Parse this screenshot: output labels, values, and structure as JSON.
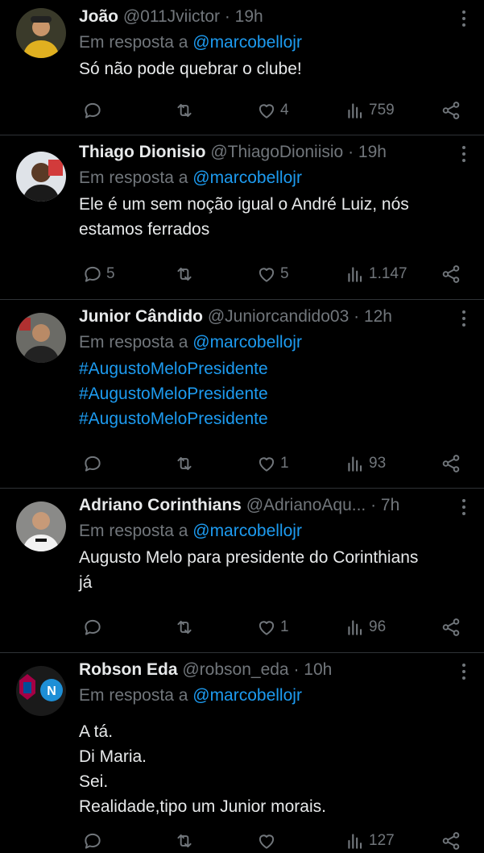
{
  "tweets": [
    {
      "name": "João",
      "handle": "@011Jviictor",
      "time": "· 19h",
      "reply_label": "Em resposta a",
      "reply_to": "@marcobellojr",
      "lines": [
        "Só não pode quebrar o clube!"
      ],
      "replies": "",
      "likes": "4",
      "views": "759"
    },
    {
      "name": "Thiago Dionisio",
      "handle": "@ThiagoDioniisio",
      "time": "· 19h",
      "reply_label": "Em resposta a",
      "reply_to": "@marcobellojr",
      "lines": [
        "Ele é um sem noção igual o André Luiz, nós",
        "estamos ferrados"
      ],
      "replies": "5",
      "likes": "5",
      "views": "1.147"
    },
    {
      "name": "Junior Cândido",
      "handle": "@Juniorcandido03",
      "time": "· 12h",
      "reply_label": "Em resposta a",
      "reply_to": "@marcobellojr",
      "lines": [
        "#AugustoMeloPresidente",
        "#AugustoMeloPresidente",
        "#AugustoMeloPresidente"
      ],
      "replies": "",
      "likes": "1",
      "views": "93"
    },
    {
      "name": "Adriano Corinthians",
      "handle": "@AdrianoAqu...",
      "time": "· 7h",
      "reply_label": "Em resposta a",
      "reply_to": "@marcobellojr",
      "lines": [
        "Augusto Melo para presidente do Corinthians",
        "já"
      ],
      "replies": "",
      "likes": "1",
      "views": "96"
    },
    {
      "name": "Robson Eda",
      "handle": "@robson_eda",
      "time": "· 10h",
      "reply_label": "Em resposta a",
      "reply_to": "@marcobellojr",
      "lines": [
        "A tá.",
        "Di Maria.",
        "Sei.",
        "Realidade,tipo um Junior morais."
      ],
      "replies": "",
      "likes": "",
      "views": "127"
    }
  ],
  "colors": {
    "background": "#000000",
    "text": "#e7e9ea",
    "muted": "#71767b",
    "link": "#1d9bf0",
    "divider": "#2f3336"
  },
  "icons": [
    "reply-icon",
    "retweet-icon",
    "like-icon",
    "views-icon",
    "share-icon",
    "more-icon"
  ]
}
